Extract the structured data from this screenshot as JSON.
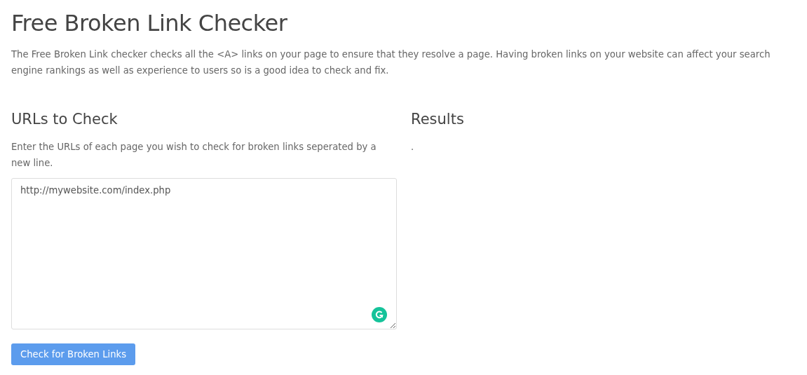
{
  "title": "Free Broken Link Checker",
  "description": "The Free Broken Link checker checks all the <A> links on your page to ensure that they resolve a page. Having broken links on your website can affect your search engine rankings as well as experience to users so is a good idea to check and fix.",
  "urls_panel": {
    "heading": "URLs to Check",
    "instructions": "Enter the URLs of each page you wish to check for broken links seperated by a new line.",
    "urls_value": "http://mywebsite.com/index.php",
    "submit_button": "Check for Broken Links"
  },
  "results_panel": {
    "heading": "Results",
    "output": "."
  }
}
